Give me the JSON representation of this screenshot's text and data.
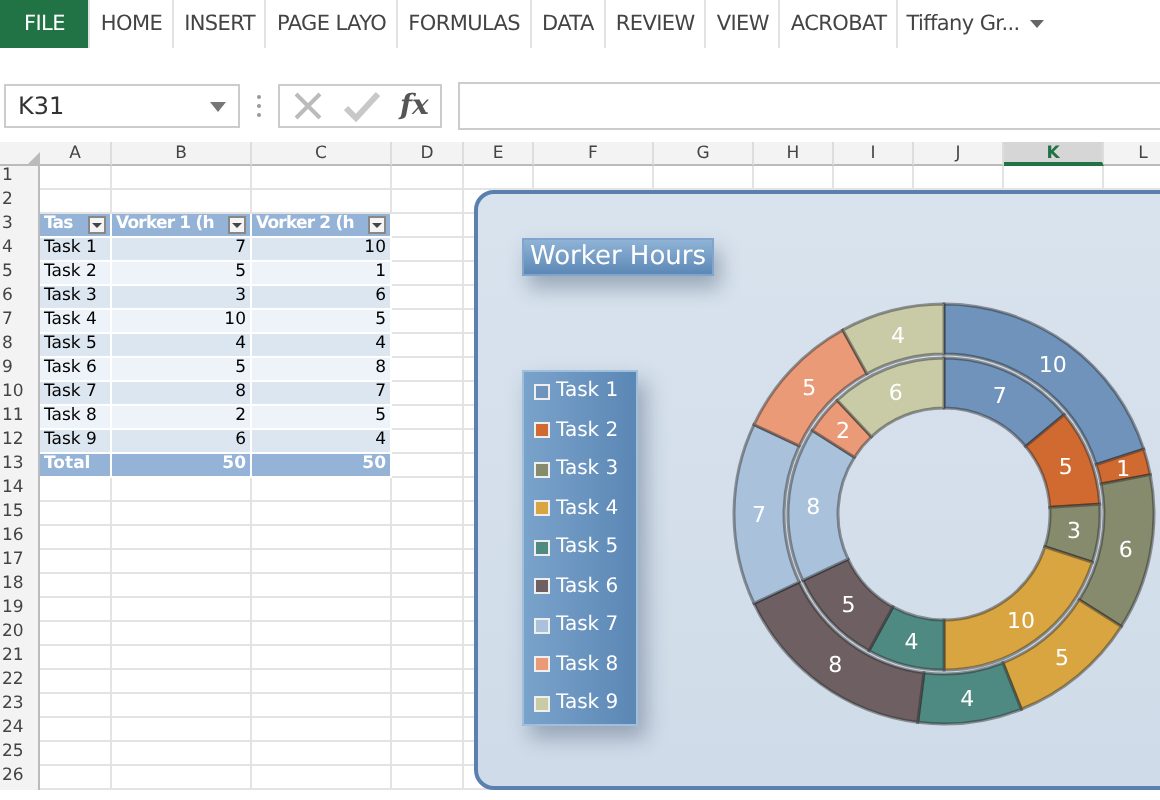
{
  "ribbon": {
    "tabs": [
      {
        "label": "FILE",
        "selected": true
      },
      {
        "label": "HOME",
        "selected": false
      },
      {
        "label": "INSERT",
        "selected": false
      },
      {
        "label": "PAGE LAYO",
        "selected": false
      },
      {
        "label": "FORMULAS",
        "selected": false
      },
      {
        "label": "DATA",
        "selected": false
      },
      {
        "label": "REVIEW",
        "selected": false
      },
      {
        "label": "VIEW",
        "selected": false
      },
      {
        "label": "ACROBAT",
        "selected": false
      }
    ],
    "account": "Tiffany Gr..."
  },
  "formula_bar": {
    "name_box": "K31",
    "function_label": "fx"
  },
  "sheet": {
    "columns": [
      {
        "label": "A",
        "selected": false
      },
      {
        "label": "B",
        "selected": false
      },
      {
        "label": "C",
        "selected": false
      },
      {
        "label": "D",
        "selected": false
      },
      {
        "label": "E",
        "selected": false
      },
      {
        "label": "F",
        "selected": false
      },
      {
        "label": "G",
        "selected": false
      },
      {
        "label": "H",
        "selected": false
      },
      {
        "label": "I",
        "selected": false
      },
      {
        "label": "J",
        "selected": false
      },
      {
        "label": "K",
        "selected": true
      },
      {
        "label": "L",
        "selected": false
      }
    ],
    "row_numbers": [
      "1",
      "2",
      "3",
      "4",
      "5",
      "6",
      "7",
      "8",
      "9",
      "10",
      "11",
      "12",
      "13",
      "14",
      "15",
      "16",
      "17",
      "18",
      "19",
      "20",
      "21",
      "22",
      "23",
      "24",
      "25",
      "26"
    ],
    "table": {
      "header": [
        "Tas",
        "Vorker 1 (h",
        "Vorker 2 (h"
      ],
      "rows": [
        [
          "Task 1",
          "7",
          "10"
        ],
        [
          "Task 2",
          "5",
          "1"
        ],
        [
          "Task 3",
          "3",
          "6"
        ],
        [
          "Task 4",
          "10",
          "5"
        ],
        [
          "Task 5",
          "4",
          "4"
        ],
        [
          "Task 6",
          "5",
          "8"
        ],
        [
          "Task 7",
          "8",
          "7"
        ],
        [
          "Task 8",
          "2",
          "5"
        ],
        [
          "Task 9",
          "6",
          "4"
        ]
      ],
      "total": [
        "Total",
        "50",
        "50"
      ]
    }
  },
  "chart": {
    "chart_data": {
      "type": "donut",
      "title": "Worker Hours",
      "legend": true,
      "categories": [
        "Task 1",
        "Task 2",
        "Task 3",
        "Task 4",
        "Task 5",
        "Task 6",
        "Task 7",
        "Task 8",
        "Task 9"
      ],
      "data_labels": true,
      "series": [
        {
          "colors": [
            "#6f93bb",
            "#d06a30",
            "#858b6c",
            "#d8a541",
            "#4f8a82",
            "#6e5f62",
            "#a9c1da",
            "#eb9a78",
            "#c9cba6"
          ],
          "values": [
            7,
            5,
            3,
            10,
            4,
            5,
            8,
            2,
            6
          ]
        },
        {
          "colors": [
            "#6f93bb",
            "#d06a30",
            "#858b6c",
            "#d8a541",
            "#4f8a82",
            "#6e5f62",
            "#a9c1da",
            "#eb9a78",
            "#c9cba6"
          ],
          "values": [
            10,
            1,
            6,
            5,
            4,
            8,
            7,
            5,
            4
          ]
        }
      ]
    }
  }
}
